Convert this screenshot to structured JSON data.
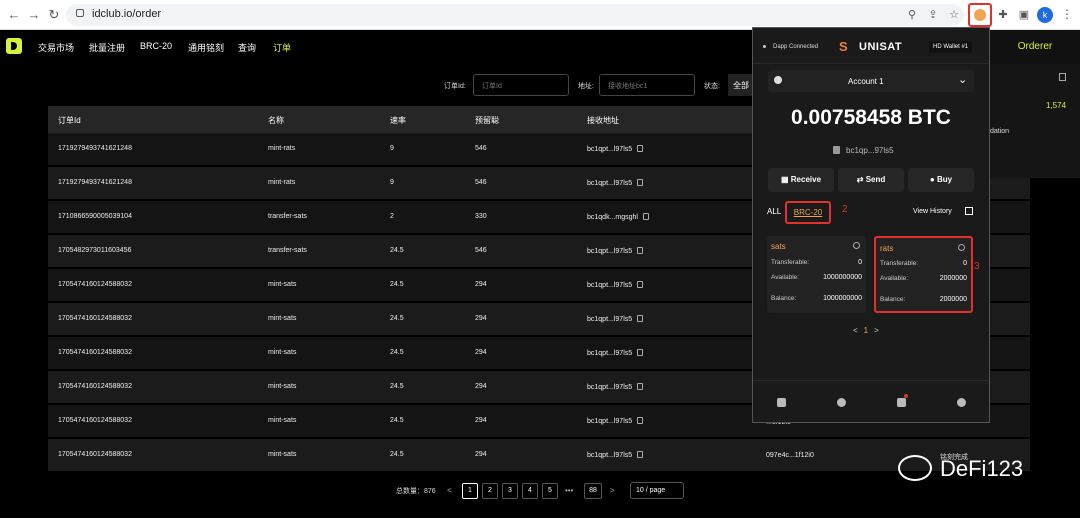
{
  "browser": {
    "url": "idclub.io/order",
    "avatar": "k",
    "nums": {
      "n1": "1",
      "n2": "2",
      "n3": "3"
    }
  },
  "nav": [
    "交易市场",
    "批量注册",
    "BRC-20",
    "通用铭刻",
    "查询",
    "订单"
  ],
  "side_button": "Orderer",
  "filters": {
    "order_label": "订单Id:",
    "order_ph": "订单Id",
    "addr_label": "地址:",
    "addr_ph": "接收地址bc1",
    "status_label": "状态:",
    "status_val": "全部"
  },
  "table": {
    "headers": [
      "订单Id",
      "名称",
      "速率",
      "预留聪",
      "接收地址"
    ],
    "rows": [
      [
        "1719279493741621248",
        "mint-rats",
        "9",
        "546",
        "bc1qpt...l97ls5"
      ],
      [
        "1719279493741621248",
        "mint-rats",
        "9",
        "546",
        "bc1qpt...l97ls5"
      ],
      [
        "1710866590005039104",
        "transfer-sats",
        "2",
        "330",
        "bc1qdk...mgsghl"
      ],
      [
        "1705482973011603456",
        "transfer-sats",
        "24.5",
        "546",
        "bc1qpt...l97ls5"
      ],
      [
        "1705474160124588032",
        "mint-sats",
        "24.5",
        "294",
        "bc1qpt...l97ls5"
      ],
      [
        "1705474160124588032",
        "mint-sats",
        "24.5",
        "294",
        "bc1qpt...l97ls5"
      ],
      [
        "1705474160124588032",
        "mint-sats",
        "24.5",
        "294",
        "bc1qpt...l97ls5"
      ],
      [
        "1705474160124588032",
        "mint-sats",
        "24.5",
        "294",
        "bc1qpt...l97ls5"
      ],
      [
        "1705474160124588032",
        "mint-sats",
        "24.5",
        "294",
        "bc1qpt...l97ls5"
      ],
      [
        "1705474160124588032",
        "mint-sats",
        "24.5",
        "294",
        "bc1qpt...l97ls5"
      ]
    ],
    "frag_hash": "...1f12i0",
    "frag_hash2": "097e4c...1f12i0",
    "frag_status": "铭刻完成"
  },
  "right_frag": {
    "a": "1,574",
    "b": "dation",
    "c": "0"
  },
  "pagination": {
    "total": "总数量：876",
    "pages": [
      "1",
      "2",
      "3",
      "4",
      "5",
      "88"
    ],
    "dots": "•••",
    "prev": "<",
    "next": ">",
    "size": "10 / page"
  },
  "popup": {
    "dapp": "Dapp Connected",
    "brand": "UNISAT",
    "hd": "HD Wallet #1",
    "account": "Account 1",
    "balance": "0.00758458 BTC",
    "address": "bc1qp...97ls5",
    "actions": [
      "Receive",
      "Send",
      "Buy"
    ],
    "action_icons": [
      "grid-icon",
      "arrows-icon",
      "coin-icon"
    ],
    "all": "ALL",
    "brc20": "BRC-20",
    "view_history": "View History",
    "tokens": [
      {
        "name": "sats",
        "transferable": "0",
        "available": "1000000000",
        "balance": "1000000000"
      },
      {
        "name": "rats",
        "transferable": "0",
        "available": "2000000",
        "balance": "2000000"
      }
    ],
    "labels": {
      "transferable": "Transferable:",
      "available": "Available:",
      "balance": "Balance:"
    },
    "page": "1",
    "prev": "<",
    "next": ">"
  },
  "watermark": "DeFi123",
  "colors": {
    "accent": "#d6f23b",
    "unisat": "#f07f31",
    "highlight": "#e0322a"
  }
}
